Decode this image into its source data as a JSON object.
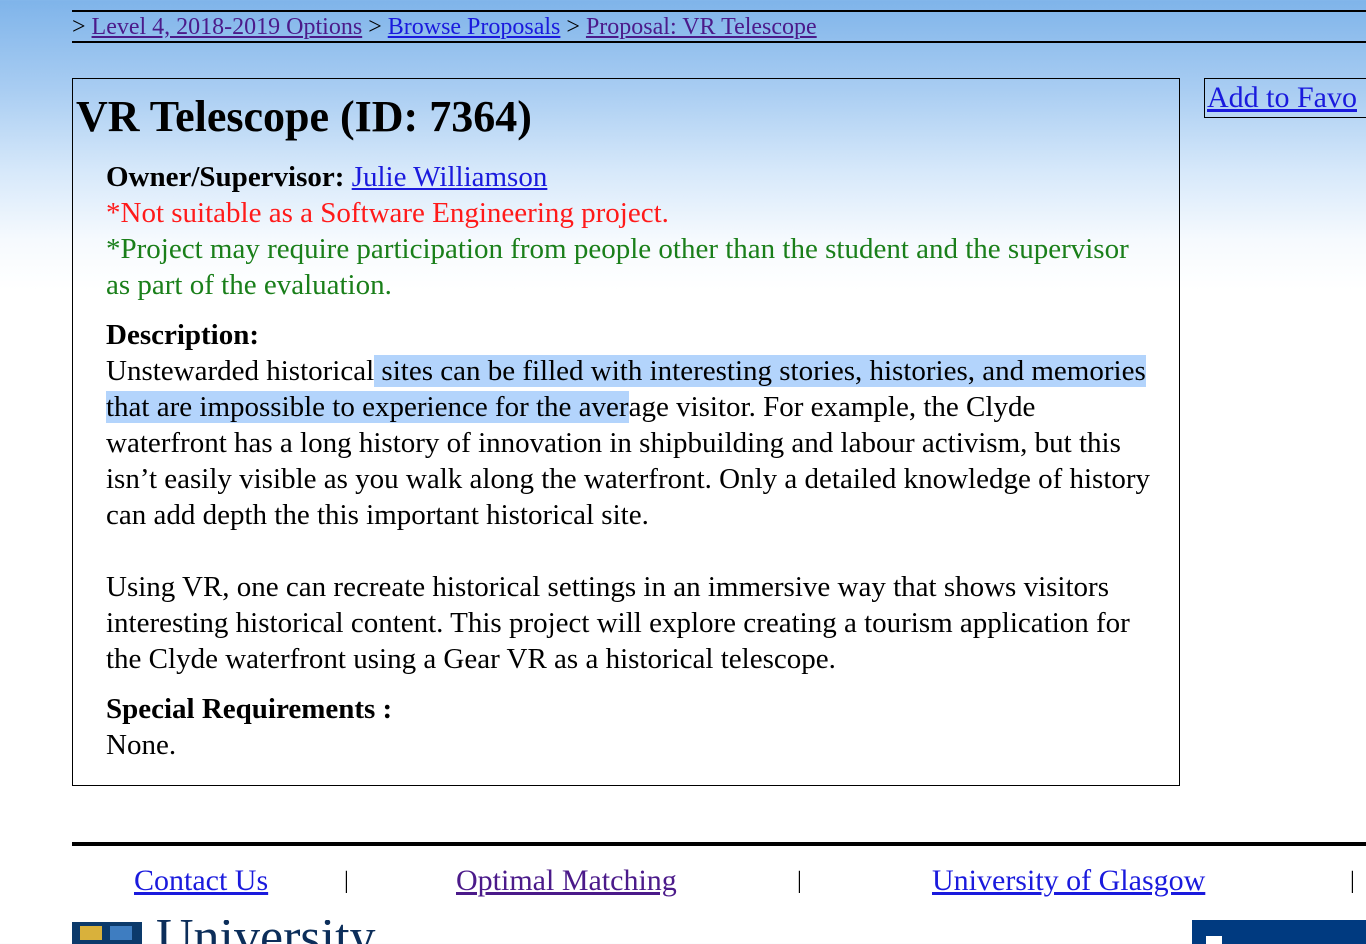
{
  "breadcrumb": {
    "prefix": ">",
    "items": [
      {
        "label": "Level 4, 2018-2019 Options"
      },
      {
        "label": "Browse Proposals"
      },
      {
        "label": "Proposal: VR Telescope"
      }
    ],
    "separator": ">"
  },
  "favourite_button": {
    "label": "Add to Favo"
  },
  "proposal": {
    "title": "VR Telescope (ID: 7364)",
    "owner_label": "Owner/Supervisor:",
    "owner_name": "Julie Williamson",
    "note_red": "*Not suitable as a Software Engineering project.",
    "note_green": "*Project may require participation from people other than the student and the supervisor as part of the evaluation.",
    "description_label": "Description:",
    "description_p1_before_selection": "Unstewarded historical",
    "description_p1_selected": " sites can be filled with interesting stories, histories, and memories that are impossible to experience for the aver",
    "description_p1_after_selection": "age visitor. For example, the Clyde waterfront has a long history of innovation in shipbuilding and labour activism, but this isn’t easily visible as you walk along the waterfront. Only a detailed knowledge of history can add depth the this important historical site.",
    "description_p2": "Using VR, one can recreate historical settings in an immersive way that shows visitors interesting historical content. This project will explore creating a tourism application for the Clyde waterfront using a Gear VR as a historical telescope.",
    "special_label": "Special Requirements :",
    "special_value": "None."
  },
  "footer": {
    "links": [
      {
        "label": "Contact Us"
      },
      {
        "label": "Optimal Matching"
      },
      {
        "label": "University of Glasgow"
      }
    ],
    "separator": "|",
    "logo_text": "University"
  },
  "colors": {
    "link": "#1a1add",
    "visited_link": "#4b1a8a",
    "note_red": "#ff1a1a",
    "note_green": "#1a7f1a",
    "selection": "#b3d4fc"
  }
}
